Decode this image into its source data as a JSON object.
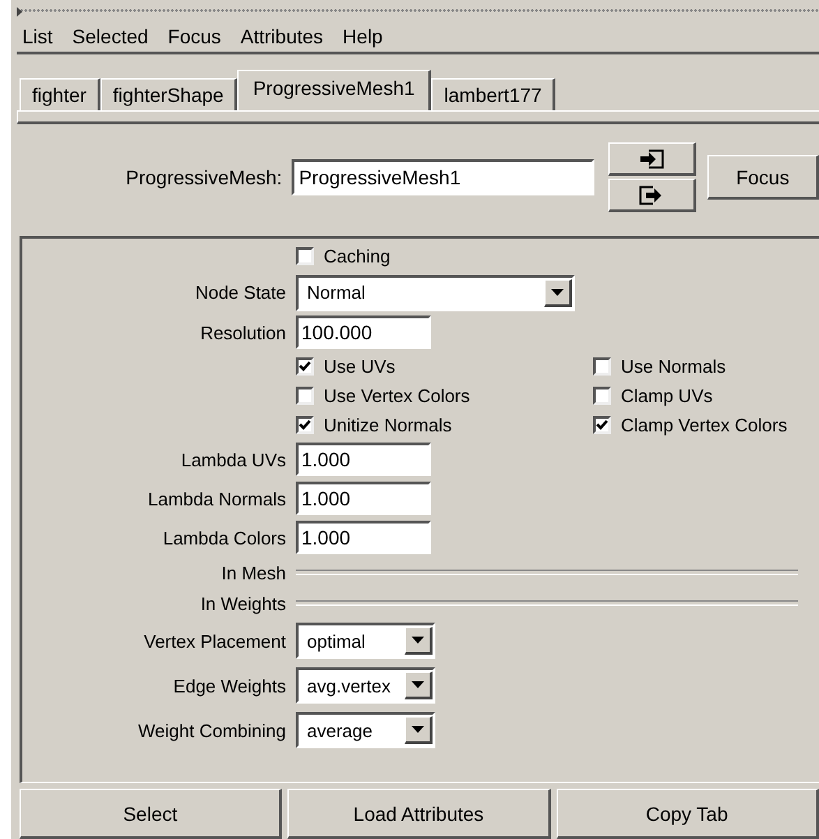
{
  "menu": [
    "List",
    "Selected",
    "Focus",
    "Attributes",
    "Help"
  ],
  "tabs": [
    {
      "label": "fighter",
      "selected": false
    },
    {
      "label": "fighterShape",
      "selected": false
    },
    {
      "label": "ProgressiveMesh1",
      "selected": true
    },
    {
      "label": "lambert177",
      "selected": false
    }
  ],
  "header": {
    "label": "ProgressiveMesh:",
    "value": "ProgressiveMesh1",
    "focus_button": "Focus"
  },
  "attributes": [
    {
      "kind": "checkbox",
      "label": "Caching",
      "checked": false
    },
    {
      "kind": "wide-dropdown",
      "label": "Node State",
      "value": "Normal"
    },
    {
      "kind": "field",
      "label": "Resolution",
      "value": "100.000"
    },
    {
      "kind": "checkpair",
      "left": {
        "label": "Use UVs",
        "checked": true
      },
      "right": {
        "label": "Use Normals",
        "checked": false
      }
    },
    {
      "kind": "checkpair",
      "left": {
        "label": "Use Vertex Colors",
        "checked": false
      },
      "right": {
        "label": "Clamp UVs",
        "checked": false
      }
    },
    {
      "kind": "checkpair",
      "left": {
        "label": "Unitize Normals",
        "checked": true
      },
      "right": {
        "label": "Clamp Vertex Colors",
        "checked": true
      }
    },
    {
      "kind": "field",
      "label": "Lambda UVs",
      "value": "1.000"
    },
    {
      "kind": "field",
      "label": "Lambda Normals",
      "value": "1.000"
    },
    {
      "kind": "field",
      "label": "Lambda Colors",
      "value": "1.000"
    },
    {
      "kind": "connection",
      "label": "In Mesh"
    },
    {
      "kind": "connection",
      "label": "In Weights"
    },
    {
      "kind": "dropdown",
      "label": "Vertex Placement",
      "value": "optimal"
    },
    {
      "kind": "dropdown",
      "label": "Edge Weights",
      "value": "avg.vertex"
    },
    {
      "kind": "dropdown",
      "label": "Weight Combining",
      "value": "average"
    }
  ],
  "buttons": [
    "Select",
    "Load Attributes",
    "Copy Tab"
  ]
}
